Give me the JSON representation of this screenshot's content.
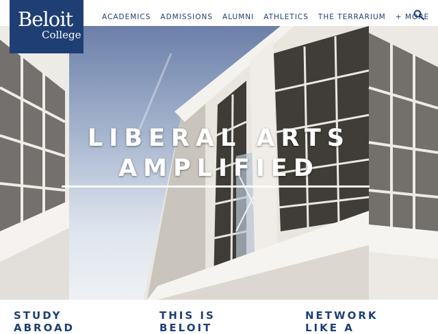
{
  "logo": {
    "line1": "Beloit",
    "line2": "College"
  },
  "nav": {
    "items": [
      "ACADEMICS",
      "ADMISSIONS",
      "ALUMNI",
      "ATHLETICS",
      "THE TERRARIUM",
      "+ MORE"
    ]
  },
  "hero": {
    "headline_line1": "LIBERAL ARTS",
    "headline_line2": "AMPLIFIED"
  },
  "teasers": [
    {
      "line1": "STUDY",
      "line2": "ABROAD"
    },
    {
      "line1": "THIS IS",
      "line2": "BELOIT"
    },
    {
      "line1": "NETWORK",
      "line2": "LIKE A"
    }
  ],
  "colors": {
    "brand_navy": "#1f3e74",
    "white": "#ffffff"
  }
}
